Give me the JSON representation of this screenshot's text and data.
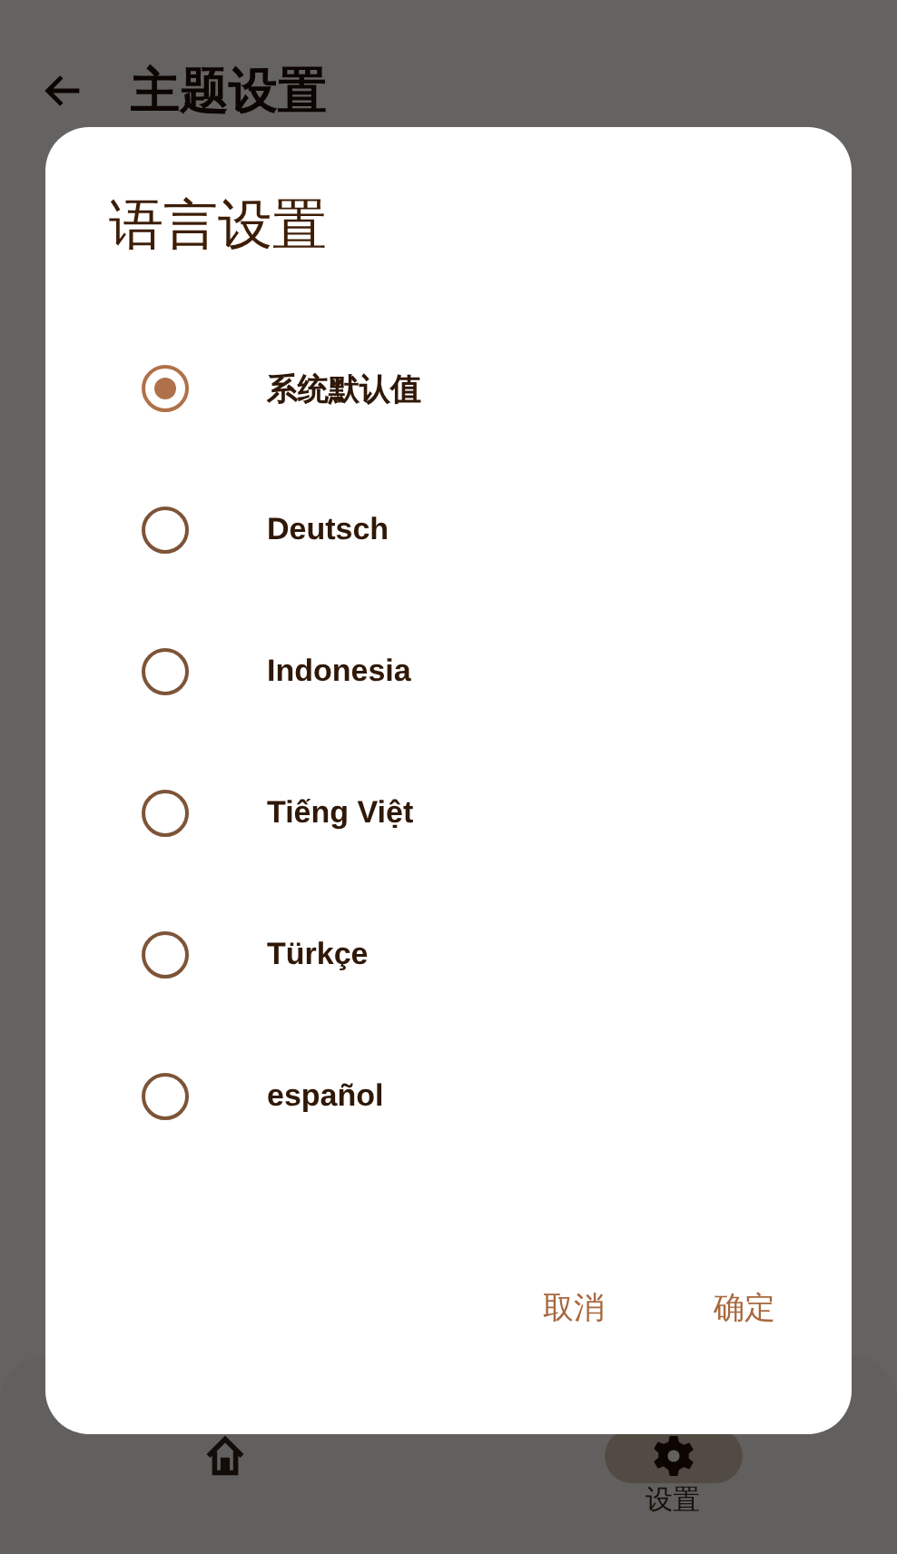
{
  "header": {
    "title": "主题设置"
  },
  "bottom_nav": {
    "items": [
      {
        "kind": "home",
        "selected": false
      },
      {
        "kind": "settings",
        "label": "设置",
        "selected": true
      }
    ]
  },
  "dialog": {
    "title": "语言设置",
    "options": [
      {
        "label": "系统默认值",
        "selected": true
      },
      {
        "label": "Deutsch",
        "selected": false
      },
      {
        "label": "Indonesia",
        "selected": false
      },
      {
        "label": "Tiếng Việt",
        "selected": false
      },
      {
        "label": "Türkçe",
        "selected": false
      },
      {
        "label": "español",
        "selected": false
      }
    ],
    "buttons": [
      "取消",
      "确定"
    ]
  }
}
